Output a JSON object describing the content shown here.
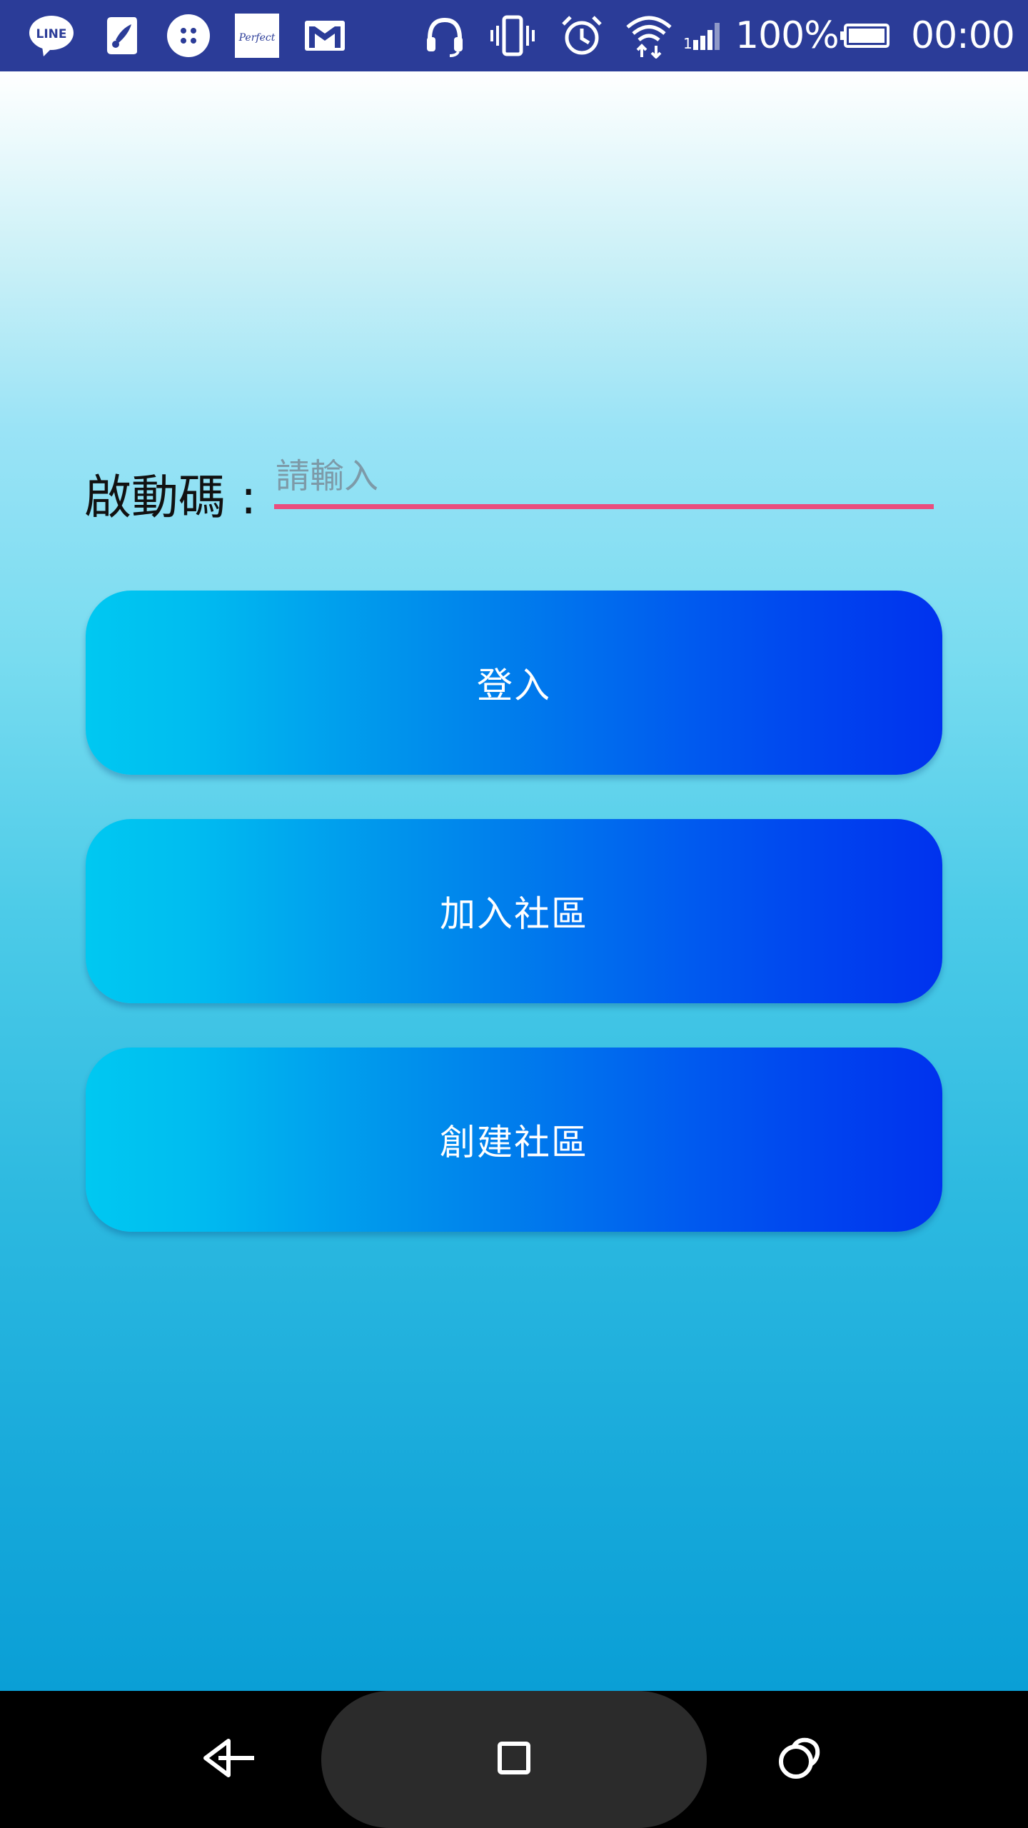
{
  "status_bar": {
    "notification_icons": [
      "line-icon",
      "paint-icon",
      "dots-app-icon",
      "perfect-app-icon",
      "gmail-icon"
    ],
    "system_icons": [
      "headset-icon",
      "vibrate-icon",
      "alarm-icon",
      "wifi-icon",
      "signal-icon"
    ],
    "battery_percent": "100%",
    "time": "00:00",
    "line_logo_text": "LINE",
    "perfect_logo_text": "Perfect"
  },
  "form": {
    "code_label": "啟動碼 :",
    "code_placeholder": "請輸入",
    "code_value": ""
  },
  "buttons": {
    "login": "登入",
    "join_community": "加入社區",
    "create_community": "創建社區"
  },
  "nav_bar": {
    "back": "back-icon",
    "home": "home-square-icon",
    "recents": "recents-icon"
  },
  "colors": {
    "status_bar_bg": "#2b3c98",
    "input_underline": "#ea4d7e",
    "button_gradient_start": "#00c8f1",
    "button_gradient_end": "#0032ee",
    "nav_bar_bg": "#000000",
    "nav_pill": "#2b2b2b"
  }
}
